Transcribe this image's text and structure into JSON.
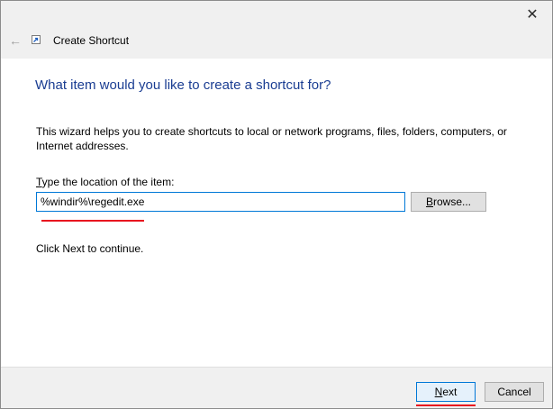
{
  "window": {
    "close_glyph": "✕"
  },
  "header": {
    "back_glyph": "←",
    "title": "Create Shortcut"
  },
  "content": {
    "question": "What item would you like to create a shortcut for?",
    "description": "This wizard helps you to create shortcuts to local or network programs, files, folders, computers, or Internet addresses.",
    "location_label_access_key": "T",
    "location_label_rest": "ype the location of the item:",
    "location_value": "%windir%\\regedit.exe",
    "browse_access_key": "B",
    "browse_rest": "rowse...",
    "continue_text": "Click Next to continue."
  },
  "footer": {
    "next_access_key": "N",
    "next_rest": "ext",
    "cancel_label": "Cancel"
  },
  "colors": {
    "accent_blue": "#0078d7",
    "heading_blue": "#1a3d92",
    "highlight_red": "#e8121f"
  },
  "icons": {
    "back": "back-arrow-icon",
    "shortcut": "shortcut-icon",
    "close": "close-icon"
  }
}
